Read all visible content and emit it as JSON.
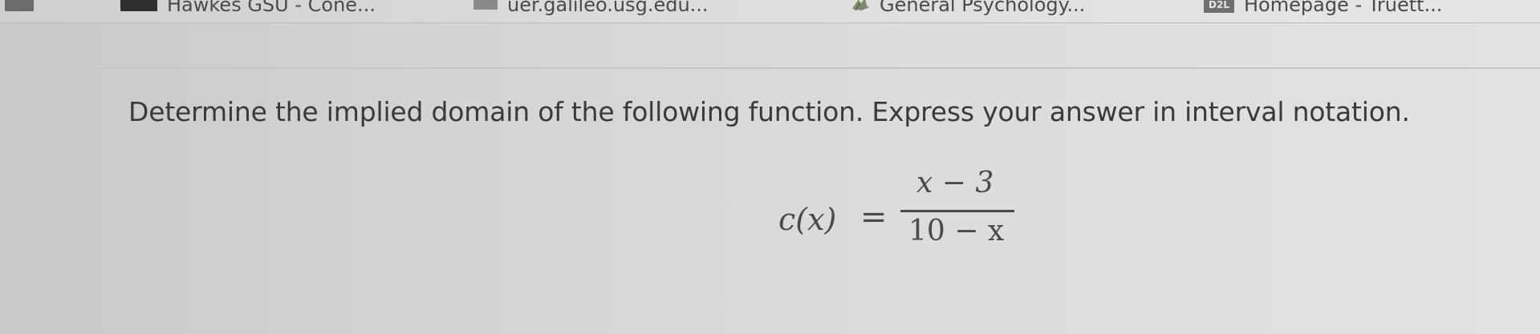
{
  "bookmarks_bar": {
    "items": [
      {
        "label": "",
        "icon": "page-icon"
      },
      {
        "label": "Hawkes GSU - Cone...",
        "icon": "hawkes-learning-icon"
      },
      {
        "label": "uer.galileo.usg.edu...",
        "icon": "galileo-icon"
      },
      {
        "label": "General Psychology...",
        "icon": "psychology-leaf-icon"
      },
      {
        "label": "Homepage - Truett...",
        "icon": "d2l-icon",
        "icon_text": "D2L"
      }
    ]
  },
  "question": {
    "prompt": "Determine the implied domain of the following function. Express your answer in interval notation."
  },
  "formula": {
    "lhs": "c(x)",
    "equals": "=",
    "numerator": "x − 3",
    "denominator": "10 − x"
  },
  "colors": {
    "text": "#3a3a3a",
    "page_background": "#dcdcda"
  }
}
